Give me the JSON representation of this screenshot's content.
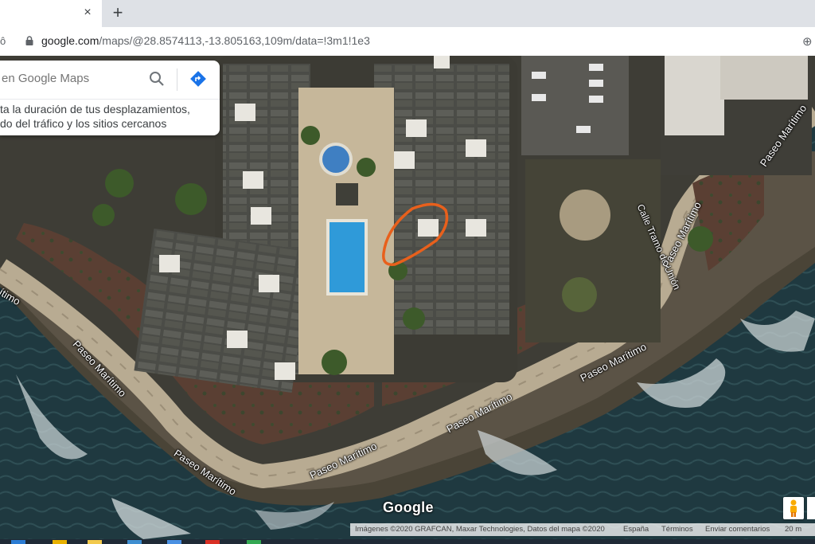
{
  "browser": {
    "tab_close": "×",
    "new_tab": "+",
    "url_host": "google.com",
    "url_path": "/maps/@28.8574113,-13.805163,109m/data=!3m1!1e3",
    "left_glyph": "ô"
  },
  "search": {
    "placeholder": "en Google Maps",
    "promo_line1": "ta la duración de tus desplazamientos,",
    "promo_line2": "do del tráfico y los sitios cercanos"
  },
  "map": {
    "labels": {
      "street_vertical": "Calle Tramo de Unión",
      "paseo_1": "Paseo Marítimo",
      "paseo_2": "Paseo Marítimo",
      "paseo_3": "Paseo Marítimo",
      "paseo_4": "Paseo Marítimo",
      "paseo_5": "Paseo Marítimo",
      "paseo_6": "Paseo Marítimo",
      "paseo_7": "Paseo Marítimo",
      "paseo_8": "Paseo Marítimo",
      "paseo_left": "ítimo"
    },
    "logo": "Google",
    "attribution": {
      "imagery": "Imágenes ©2020 GRAFCAN, Maxar Technologies, Datos del mapa ©2020",
      "country": "España",
      "terms": "Términos",
      "feedback": "Enviar comentarios",
      "scale": "20 m"
    },
    "highlight_color": "#e8601c"
  }
}
